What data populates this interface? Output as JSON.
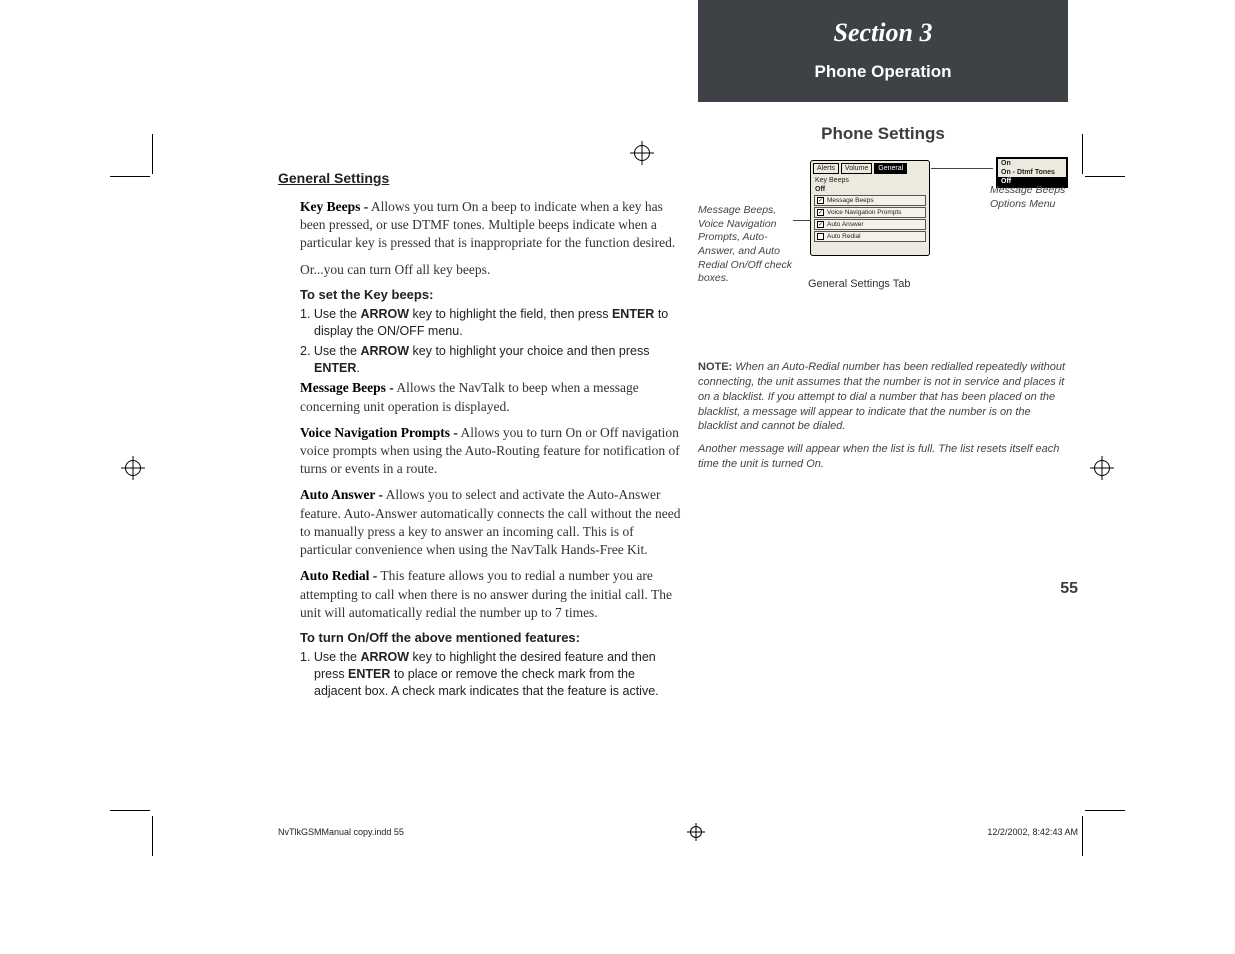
{
  "left": {
    "section_heading": "General Settings",
    "key_beeps_lead": "Key Beeps -",
    "key_beeps_text": " Allows you turn On a beep to indicate when a key has been pressed, or use DTMF tones.  Multiple beeps indicate when a particular key is pressed that is inappropriate for the function desired.",
    "key_beeps_or": "Or...you can turn Off all key beeps.",
    "set_key_beeps_head": "To set the Key beeps:",
    "step1_prefix": "1. Use the ",
    "step1_kw1": "ARROW",
    "step1_mid": " key to highlight the field, then press ",
    "step1_kw2": "ENTER",
    "step1_tail": " to display the ON/OFF menu.",
    "step2_prefix": "2. Use the ",
    "step2_kw1": "ARROW",
    "step2_mid": " key to highlight your choice and then press ",
    "step2_kw2": "ENTER",
    "step2_tail": ".",
    "msg_beeps_lead": "Message Beeps -",
    "msg_beeps_text": " Allows the NavTalk to beep when a message concerning unit operation is displayed.",
    "voice_nav_lead": "Voice Navigation Prompts -",
    "voice_nav_text": " Allows you to turn On or Off navigation voice prompts when using the Auto-Routing feature for notification of turns or events in a route.",
    "auto_answer_lead": "Auto Answer -",
    "auto_answer_text": " Allows you to select and activate the Auto-Answer feature. Auto-Answer automatically connects the call without the need to manually press a key to answer an incoming call. This is of particular convenience when using the NavTalk Hands-Free Kit.",
    "auto_redial_lead": "Auto Redial -",
    "auto_redial_text": " This feature allows you to redial a number you are attempting to call when there is no answer during the initial call. The unit will automatically redial the number up to 7 times.",
    "toggle_head": "To turn On/Off the above mentioned features:",
    "toggle_step_prefix": "1. Use the ",
    "toggle_step_kw1": "ARROW",
    "toggle_step_mid": " key to highlight the desired feature and then press ",
    "toggle_step_kw2": "ENTER",
    "toggle_step_tail": " to place or remove the check mark from the adjacent box.  A check mark indicates that the feature is active."
  },
  "right": {
    "section_label": "Section 3",
    "section_title": "Phone Operation",
    "page_heading": "Phone Settings",
    "caption_left": "Message Beeps, Voice Navigation Prompts, Auto-Answer, and Auto Redial On/Off check boxes.",
    "caption_right": "Message Beeps Options Menu",
    "figure_caption": "General Settings Tab",
    "screen": {
      "tabs": [
        "Alerts",
        "Volume",
        "General"
      ],
      "line1": "Key Beeps",
      "line2": "Off",
      "rows": [
        {
          "label": "Message Beeps",
          "checked": true
        },
        {
          "label": "Voice Navigation Prompts",
          "checked": true
        },
        {
          "label": "Auto Answer",
          "checked": true
        },
        {
          "label": "Auto Redial",
          "checked": false
        }
      ]
    },
    "optmenu": {
      "opt1": "On",
      "opt2": "On - Dtmf Tones",
      "opt3": "Off"
    },
    "note_lead": "NOTE:",
    "note_body": " When an Auto-Redial number has been redialled repeatedly without connecting, the unit assumes that the number is not in service and places it on a blacklist. If you attempt to dial a number that has been placed on the blacklist, a message will appear to indicate that the number is on the blacklist and cannot be dialed.",
    "note2": "Another message will appear when the list is full. The list resets itself each time the unit is turned On.",
    "page_number": "55"
  },
  "footer": {
    "file": "NvTlkGSMManual copy.indd   55",
    "timestamp": "12/2/2002, 8:42:43 AM"
  }
}
